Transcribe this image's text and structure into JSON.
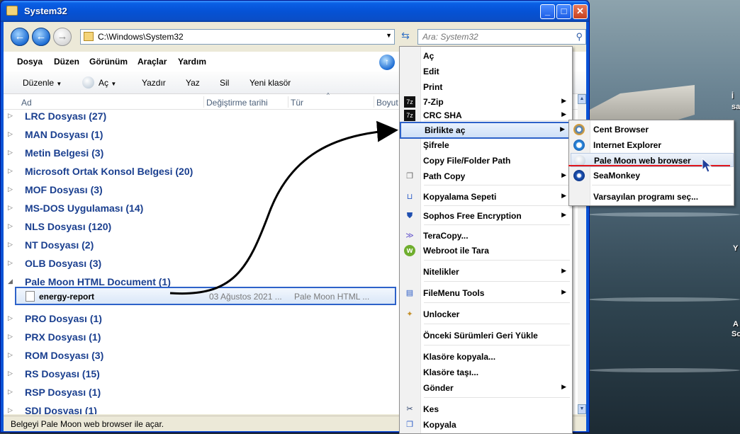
{
  "window": {
    "title": "System32",
    "address": "C:\\Windows\\System32",
    "search_placeholder": "Ara: System32"
  },
  "menubar": [
    "Dosya",
    "Düzen",
    "Görünüm",
    "Araçlar",
    "Yardım"
  ],
  "toolbar": {
    "organize": "Düzenle",
    "open": "Aç",
    "print": "Yazdır",
    "write": "Yaz",
    "delete": "Sil",
    "new_folder": "Yeni klasör"
  },
  "columns": [
    "Ad",
    "Değiştirme tarihi",
    "Tür",
    "Boyut"
  ],
  "groups": [
    "LRC Dosyası (27)",
    "MAN Dosyası (1)",
    "Metin Belgesi (3)",
    "Microsoft Ortak Konsol Belgesi (20)",
    "MOF Dosyası (3)",
    "MS-DOS Uygulaması (14)",
    "NLS Dosyası (120)",
    "NT Dosyası (2)",
    "OLB Dosyası (3)",
    "Pale Moon HTML Document (1)",
    "PRO Dosyası (1)",
    "PRX Dosyası (1)",
    "ROM Dosyası (3)",
    "RS Dosyası (15)",
    "RSP Dosyası (1)",
    "SDI Dosyası (1)"
  ],
  "selected_file": {
    "name": "energy-report",
    "date": "03 Ağustos 2021 ...",
    "type": "Pale Moon HTML ..."
  },
  "status_text": "Belgeyi Pale Moon web browser ile açar.",
  "context_menu": {
    "items": [
      "Aç",
      "Edit",
      "Print",
      "7-Zip",
      "CRC SHA",
      "Birlikte aç",
      "Şifrele",
      "Copy File/Folder Path",
      "Path Copy",
      "Kopyalama Sepeti",
      "Sophos Free Encryption",
      "TeraCopy...",
      "Webroot ile Tara",
      "Nitelikler",
      "FileMenu Tools",
      "Unlocker",
      "Önceki Sürümleri Geri Yükle",
      "Klasöre kopyala...",
      "Klasöre taşı...",
      "Gönder",
      "Kes",
      "Kopyala"
    ]
  },
  "open_with_submenu": {
    "items": [
      "Cent Browser",
      "Internet Explorer",
      "Pale Moon web browser",
      "SeaMonkey",
      "Varsayılan programı seç..."
    ]
  },
  "desktop_labels": [
    "İ",
    "sa",
    "İ",
    "Y",
    "A",
    "So"
  ],
  "colors": {
    "titlebar": "#0552d5",
    "highlight_border": "#2d62c9",
    "red_underline": "#e0161c",
    "group_text": "#1a3f8f"
  }
}
